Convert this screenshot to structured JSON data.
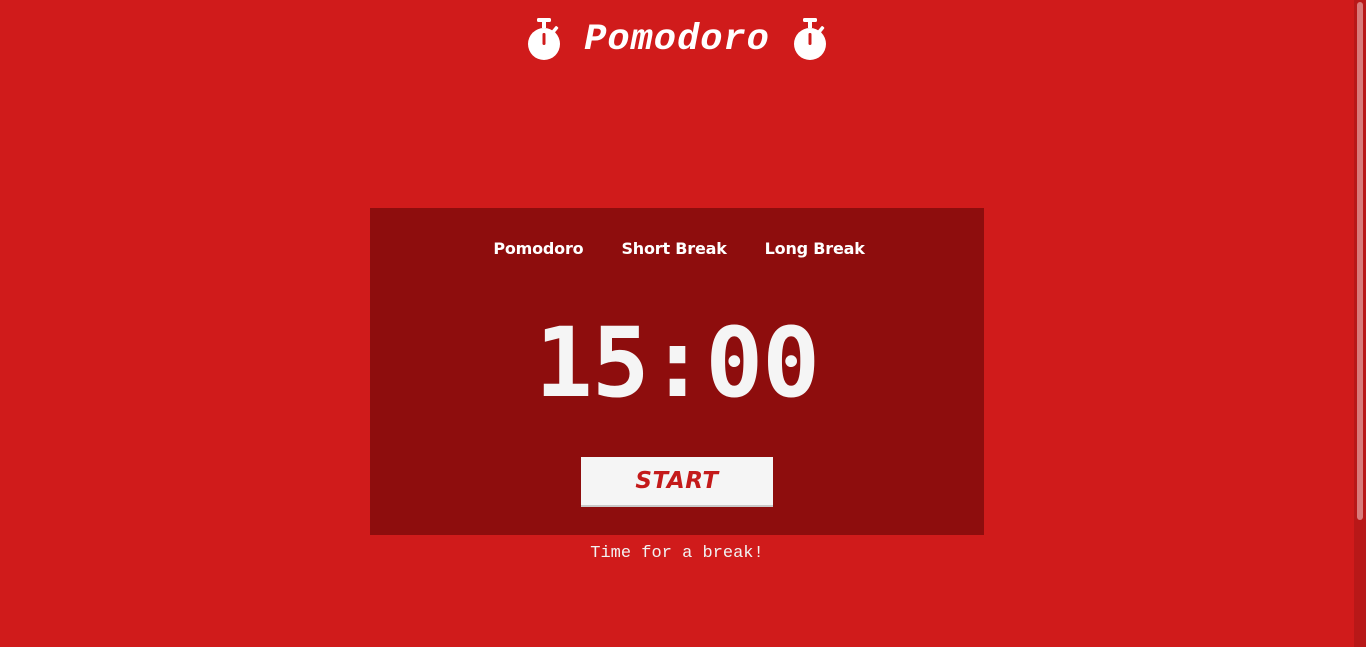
{
  "header": {
    "title": "Pomodoro",
    "left_icon": "stopwatch-icon",
    "right_icon": "stopwatch-icon"
  },
  "timer": {
    "tabs": [
      {
        "label": "Pomodoro"
      },
      {
        "label": "Short Break"
      },
      {
        "label": "Long Break"
      }
    ],
    "time": "15:00",
    "start_label": "START"
  },
  "status": {
    "message": "Time for a break!"
  },
  "colors": {
    "background": "#d01b1b",
    "card": "#8e0d0d",
    "button_bg": "#f5f5f5",
    "button_text": "#c41a1a",
    "text": "#ffffff"
  }
}
